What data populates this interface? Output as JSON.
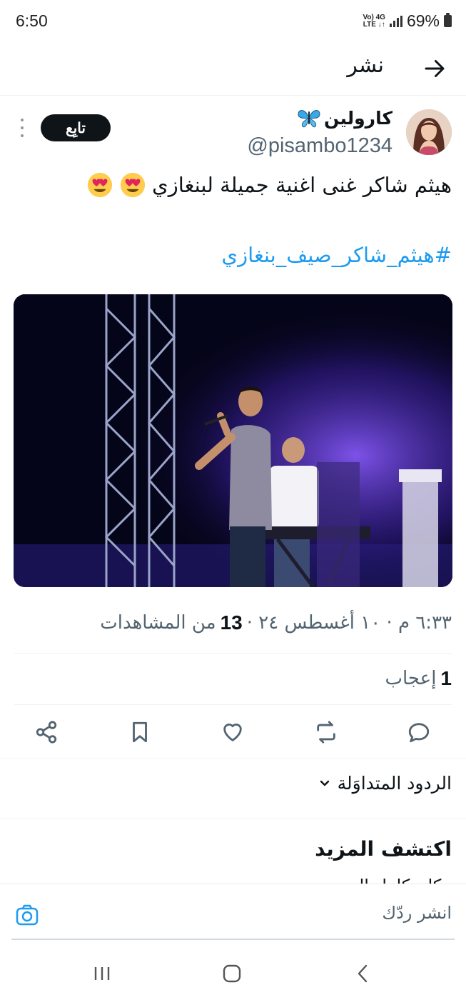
{
  "status": {
    "time": "6:50",
    "network_top": "Vo) 4G",
    "network_bottom": "LTE ↓↑",
    "battery": "69%"
  },
  "header": {
    "title": "نشر",
    "back_icon": "arrow-right-icon"
  },
  "tweet": {
    "display_name": "كارولين",
    "name_emoji": "butterfly",
    "handle": "@pisambo1234",
    "follow_label": "تابِع",
    "text": "هيثم شاكر غنى اغنية جميلة لبنغازي",
    "text_emoji": "heart-eyes",
    "hashtag": "#هيثم_شاكر_صيف_بنغازي",
    "timestamp": "٦:٣٣ م · ١٠ أغسطس ٢٤ ·",
    "views_count": "13",
    "views_label": "من المشاهدات",
    "likes_count": "1",
    "likes_label": "إعجاب"
  },
  "actions": [
    "reply-icon",
    "retweet-icon",
    "like-icon",
    "bookmark-icon",
    "share-icon"
  ],
  "replies": {
    "sort_label": "الردود المتداوَلة"
  },
  "discover": {
    "title": "اكتشف المزيد",
    "peek": "مكان كامل الـ"
  },
  "reply_bar": {
    "placeholder": "انشر ردّك"
  },
  "colors": {
    "accent": "#1d9bf0",
    "text": "#0f1419",
    "secondary": "#536471"
  }
}
